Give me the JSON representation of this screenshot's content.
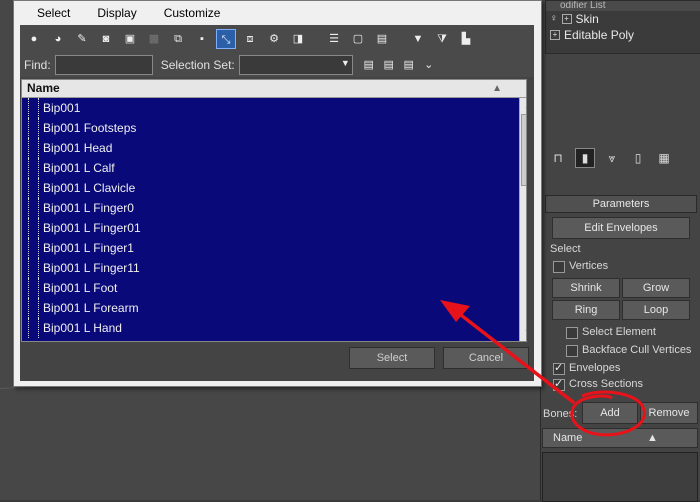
{
  "dialog": {
    "menu": [
      "Select",
      "Display",
      "Customize"
    ],
    "find_label": "Find:",
    "find_value": "",
    "selection_set_label": "Selection Set:",
    "selection_set_value": "",
    "list_header": "Name",
    "items": [
      "Bip001",
      "Bip001 Footsteps",
      "Bip001 Head",
      "Bip001 L Calf",
      "Bip001 L Clavicle",
      "Bip001 L Finger0",
      "Bip001 L Finger01",
      "Bip001 L Finger1",
      "Bip001 L Finger11",
      "Bip001 L Foot",
      "Bip001 L Forearm",
      "Bip001 L Hand"
    ],
    "select_label": "Select",
    "cancel_label": "Cancel"
  },
  "panel": {
    "modifier_list_label": "odifier List",
    "modifiers": [
      "Skin",
      "Editable Poly"
    ],
    "parameters_label": "Parameters",
    "edit_envelopes_label": "Edit Envelopes",
    "select_group_label": "Select",
    "vertices_label": "Vertices",
    "shrink_label": "Shrink",
    "grow_label": "Grow",
    "ring_label": "Ring",
    "loop_label": "Loop",
    "select_element_label": "Select Element",
    "backface_label": "Backface Cull Vertices",
    "envelopes_label": "Envelopes",
    "envelopes_checked": true,
    "cross_sections_label": "Cross Sections",
    "cross_sections_checked": true,
    "bones_label": "Bones:",
    "add_label": "Add",
    "remove_label": "Remove",
    "bones_list_header": "Name"
  },
  "colors": {
    "list_bg": "#090979",
    "annotation": "#e8121a"
  }
}
